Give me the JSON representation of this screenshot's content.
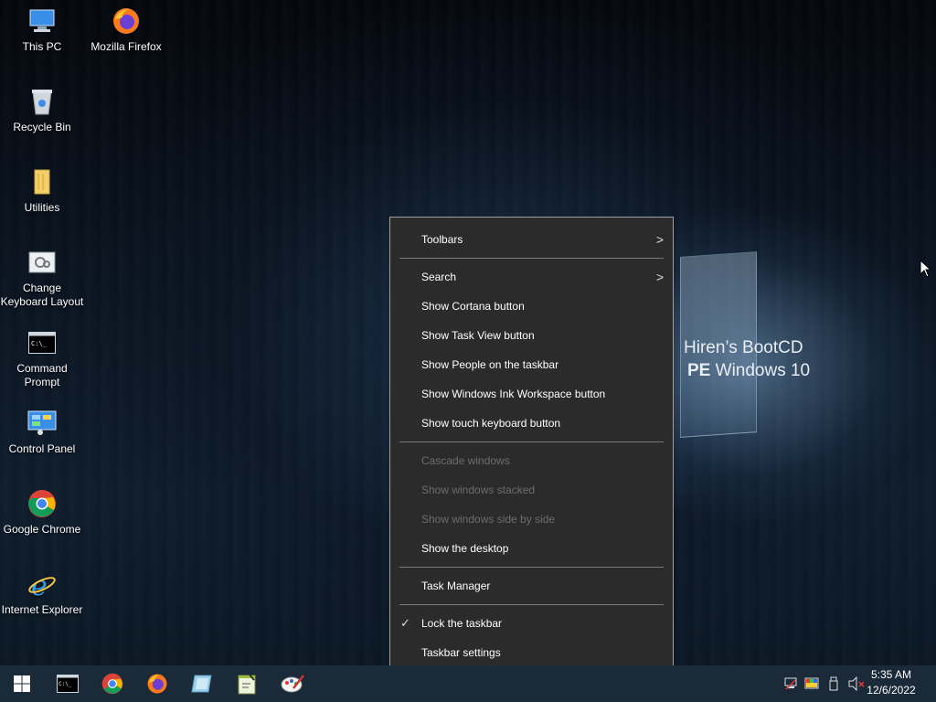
{
  "desktop": {
    "icons": [
      {
        "label": "This PC",
        "icon": "computer-icon"
      },
      {
        "label": "Mozilla Firefox",
        "icon": "firefox-icon"
      },
      {
        "label": "Recycle Bin",
        "icon": "recycle-bin-icon"
      },
      {
        "label": "Utilities",
        "icon": "folder-icon"
      },
      {
        "label": "Change Keyboard Layout",
        "icon": "keyboard-settings-icon"
      },
      {
        "label": "Command Prompt",
        "icon": "cmd-icon"
      },
      {
        "label": "Control Panel",
        "icon": "control-panel-icon"
      },
      {
        "label": "Google Chrome",
        "icon": "chrome-icon"
      },
      {
        "label": "Internet Explorer",
        "icon": "ie-icon"
      }
    ]
  },
  "wallpaper": {
    "line1": "Hiren’s BootCD",
    "line2_bold": "PE",
    "line2_rest": " Windows 10"
  },
  "context_menu": {
    "toolbars": "Toolbars",
    "search": "Search",
    "show_cortana": "Show Cortana button",
    "show_task_view": "Show Task View button",
    "show_people": "Show People on the taskbar",
    "show_ink": "Show Windows Ink Workspace button",
    "show_touch_keyboard": "Show touch keyboard button",
    "cascade": "Cascade windows",
    "stacked": "Show windows stacked",
    "side_by_side": "Show windows side by side",
    "show_desktop": "Show the desktop",
    "task_manager": "Task Manager",
    "lock_taskbar": "Lock the taskbar",
    "taskbar_settings": "Taskbar settings"
  },
  "taskbar": {
    "pinned": [
      "start-icon",
      "cmd-icon",
      "chrome-icon",
      "firefox-icon",
      "explorer-icon",
      "notepad-icon",
      "paint-icon"
    ],
    "tray": [
      "network-icon",
      "display-icon",
      "usb-icon",
      "volume-muted-icon"
    ],
    "time": "5:35 AM",
    "date": "12/6/2022"
  },
  "colors": {
    "taskbar": "#1b2a38",
    "menu_bg": "#2b2b2b",
    "disabled_text": "#6d6d6d"
  }
}
